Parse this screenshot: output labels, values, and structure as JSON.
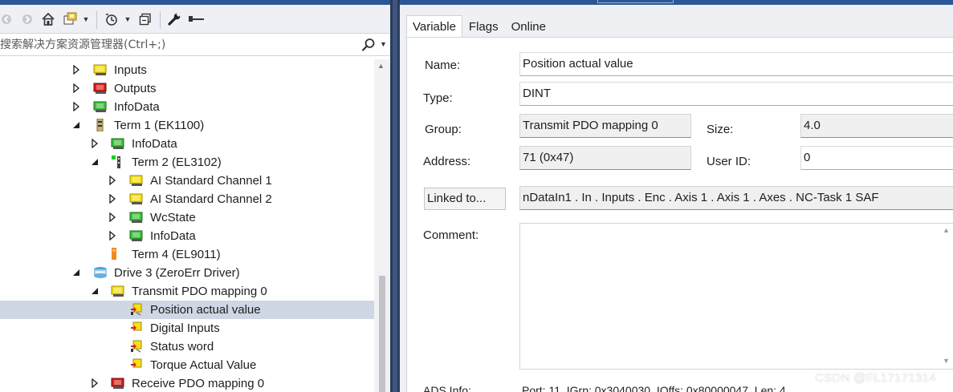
{
  "explorer": {
    "search_placeholder": "搜索解决方案资源管理器(Ctrl+;)",
    "tree": [
      {
        "label": "Inputs",
        "icon": "folder-yellow-icon",
        "expander": "collapsed",
        "selected": false
      },
      {
        "label": "Outputs",
        "icon": "folder-red-icon",
        "expander": "collapsed",
        "selected": false
      },
      {
        "label": "InfoData",
        "icon": "folder-green-icon",
        "expander": "collapsed",
        "selected": false
      },
      {
        "label": "Term 1 (EK1100)",
        "icon": "coupler-icon",
        "expander": "expanded",
        "selected": false
      },
      {
        "label": "InfoData",
        "icon": "folder-green-icon",
        "expander": "collapsed",
        "selected": false
      },
      {
        "label": "Term 2 (EL3102)",
        "icon": "terminal-green-icon",
        "expander": "expanded",
        "selected": false
      },
      {
        "label": "AI Standard Channel 1",
        "icon": "folder-yellow-icon",
        "expander": "collapsed",
        "selected": false
      },
      {
        "label": "AI Standard Channel 2",
        "icon": "folder-yellow-icon",
        "expander": "collapsed",
        "selected": false
      },
      {
        "label": "WcState",
        "icon": "folder-green-icon",
        "expander": "collapsed",
        "selected": false
      },
      {
        "label": "InfoData",
        "icon": "folder-green-icon",
        "expander": "collapsed",
        "selected": false
      },
      {
        "label": "Term 4 (EL9011)",
        "icon": "terminal-orange-icon",
        "expander": "none",
        "selected": false
      },
      {
        "label": "Drive 3 (ZeroErr Driver)",
        "icon": "drive-icon",
        "expander": "expanded",
        "selected": false
      },
      {
        "label": "Transmit PDO mapping 0",
        "icon": "folder-yellow-icon",
        "expander": "expanded",
        "selected": false
      },
      {
        "label": "Position actual value",
        "icon": "variable-linked-icon",
        "expander": "none",
        "selected": true
      },
      {
        "label": "Digital Inputs",
        "icon": "variable-icon",
        "expander": "none",
        "selected": false
      },
      {
        "label": "Status word",
        "icon": "variable-linked-icon",
        "expander": "none",
        "selected": false
      },
      {
        "label": "Torque Actual Value",
        "icon": "variable-icon",
        "expander": "none",
        "selected": false
      },
      {
        "label": "Receive PDO mapping 0",
        "icon": "folder-red-icon",
        "expander": "collapsed",
        "selected": false
      }
    ]
  },
  "properties": {
    "tabs": [
      {
        "label": "Variable",
        "active": true
      },
      {
        "label": "Flags",
        "active": false
      },
      {
        "label": "Online",
        "active": false
      }
    ],
    "name_label": "Name:",
    "name_value": "Position actual value",
    "type_label": "Type:",
    "type_value": "DINT",
    "group_label": "Group:",
    "group_value": "Transmit PDO mapping 0",
    "size_label": "Size:",
    "size_value": "4.0",
    "address_label": "Address:",
    "address_value": "71 (0x47)",
    "userid_label": "User ID:",
    "userid_value": "0",
    "linked_button": "Linked to...",
    "linked_value": "nDataIn1 . In . Inputs . Enc . Axis 1 . Axis 1 . Axes . NC-Task 1 SAF",
    "comment_label": "Comment:",
    "comment_value": "",
    "ads_label": "ADS Info:",
    "ads_value": "Port: 11, IGrp: 0x3040030, IOffs: 0x80000047, Len: 4"
  },
  "watermark": "CSDN @FL17171314",
  "colors": {
    "selection": "#cfd6e4",
    "title_bar": "#2b5797",
    "folder_yellow": "#f5e11a",
    "folder_red": "#d42020",
    "folder_green": "#3cc03c"
  }
}
